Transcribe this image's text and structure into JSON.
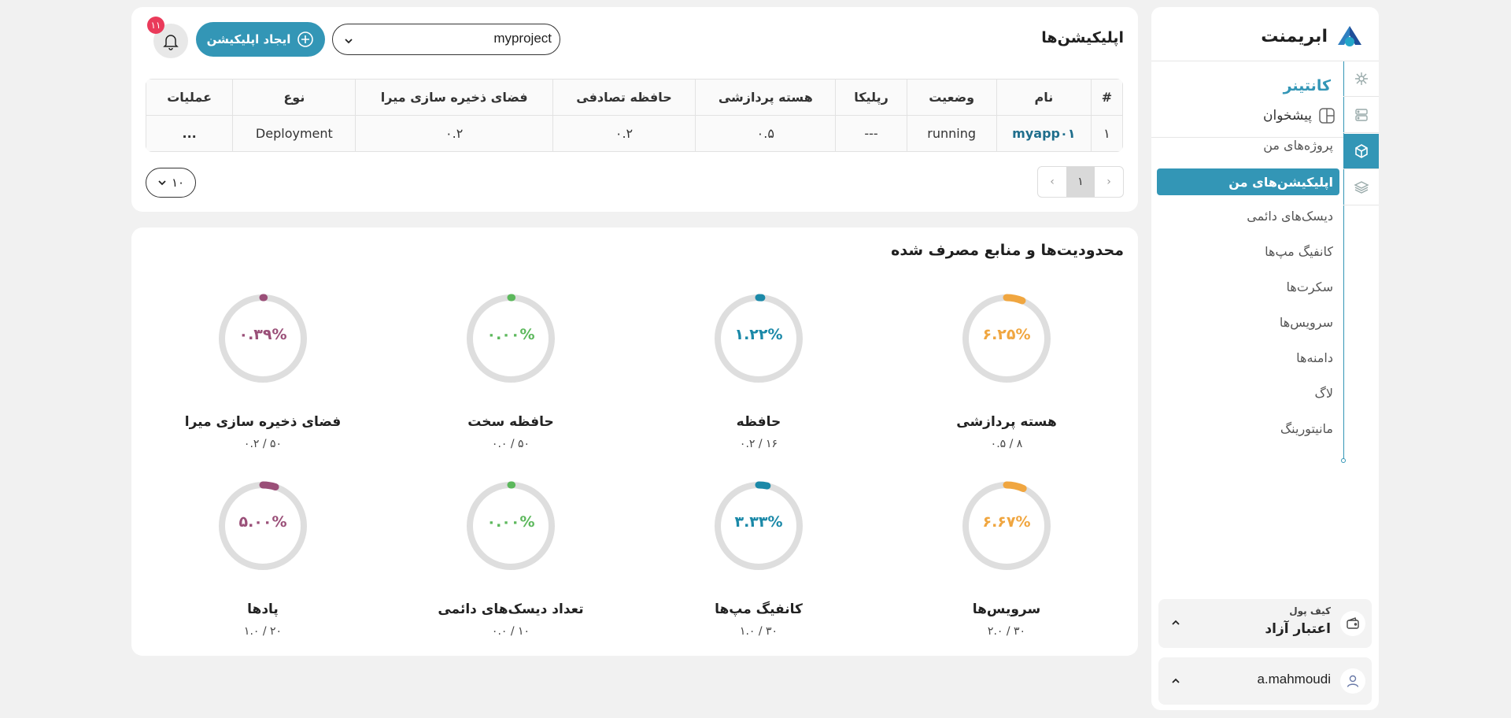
{
  "brand": {
    "name": "ابریمنت"
  },
  "sidebar": {
    "section_title": "کانتینر",
    "counter_label": "پیشخوان",
    "items": [
      {
        "label": "پروژه‌های من",
        "active": false
      },
      {
        "label": "اپلیکیشن‌های من",
        "active": true
      },
      {
        "label": "دیسک‌های دائمی",
        "active": false
      },
      {
        "label": "کانفیگ مپ‌ها",
        "active": false
      },
      {
        "label": "سکرت‌ها",
        "active": false
      },
      {
        "label": "سرویس‌ها",
        "active": false
      },
      {
        "label": "دامنه‌ها",
        "active": false
      },
      {
        "label": "لاگ",
        "active": false
      },
      {
        "label": "مانیتورینگ",
        "active": false
      }
    ],
    "rail_icons": [
      "kubernetes-icon",
      "server-icon",
      "box-icon",
      "layers-icon"
    ],
    "wallet": {
      "caption": "کیف پول",
      "value": "اعتبار آزاد"
    },
    "user": {
      "name": "a.mahmoudi"
    }
  },
  "header": {
    "title": "اپلیکیشن‌ها",
    "project_select": "myproject",
    "create_button": "ایجاد اپلیکیشن",
    "notification_count": "۱۱"
  },
  "table": {
    "columns": [
      "#",
      "نام",
      "وضعیت",
      "رپلیکا",
      "هسته پردازشی",
      "حافظه تصادفی",
      "فضای ذخیره سازی میرا",
      "نوع",
      "عملیات"
    ],
    "rows": [
      [
        "۱",
        "myapp۰۱",
        "running",
        "---",
        "۰.۵",
        "۰.۲",
        "۰.۲",
        "Deployment",
        "..."
      ]
    ]
  },
  "pagination": {
    "prev": "‹",
    "current": "۱",
    "next": "›",
    "page_size": "۱۰"
  },
  "usage": {
    "title": "محدودیت‌ها و منابع مصرف شده",
    "gauges": [
      {
        "label": "هسته پردازشی",
        "percent_text": "۶.۲۵%",
        "percent": 6.25,
        "sub": "۰.۵ / ۸",
        "color": "#f0a640"
      },
      {
        "label": "حافظه",
        "percent_text": "۱.۲۲%",
        "percent": 1.22,
        "sub": "۰.۲ / ۱۶",
        "color": "#1b89a8"
      },
      {
        "label": "حافظه سخت",
        "percent_text": "۰.۰۰%",
        "percent": 0,
        "sub": "۰.۰ / ۵۰",
        "color": "#5cb85c"
      },
      {
        "label": "فضای ذخیره سازی میرا",
        "percent_text": "۰.۳۹%",
        "percent": 0.39,
        "sub": "۰.۲ / ۵۰",
        "color": "#9a4f78"
      },
      {
        "label": "سرویس‌ها",
        "percent_text": "۶.۶۷%",
        "percent": 6.67,
        "sub": "۲.۰ / ۳۰",
        "color": "#f0a640"
      },
      {
        "label": "کانفیگ مپ‌ها",
        "percent_text": "۳.۳۳%",
        "percent": 3.33,
        "sub": "۱.۰ / ۳۰",
        "color": "#1b89a8"
      },
      {
        "label": "تعداد دیسک‌های دائمی",
        "percent_text": "۰.۰۰%",
        "percent": 0,
        "sub": "۰.۰ / ۱۰",
        "color": "#5cb85c"
      },
      {
        "label": "پادها",
        "percent_text": "۵.۰۰%",
        "percent": 5.0,
        "sub": "۱.۰ / ۲۰",
        "color": "#9a4f78"
      }
    ]
  }
}
